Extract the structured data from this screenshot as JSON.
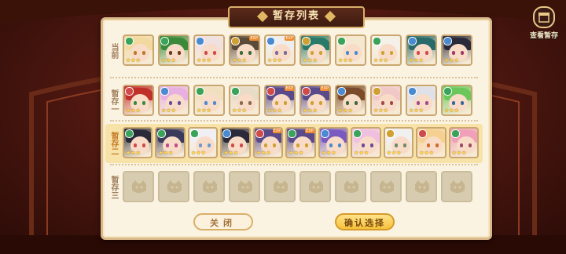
{
  "title": "暂存列表",
  "view_store_label": "查看暂存",
  "rows": [
    {
      "label": "当前",
      "highlight": false,
      "cells": [
        {
          "hair": "#f1d9a0",
          "eye": "#c0782a",
          "elem": "#3aa35a",
          "badge": ""
        },
        {
          "hair": "#3a8a3a",
          "eye": "#6a3a1a",
          "elem": "#3aa35a",
          "badge": ""
        },
        {
          "hair": "#f0e0e0",
          "eye": "#d04a4a",
          "elem": "#4a8ad0",
          "badge": ""
        },
        {
          "hair": "#5a4a3a",
          "eye": "#3a6a3a",
          "elem": "#d0a030",
          "badge": "EXP"
        },
        {
          "hair": "#eeeeee",
          "eye": "#7a6a9a",
          "elem": "#4a8ad0",
          "badge": "EXP"
        },
        {
          "hair": "#2a7a6a",
          "eye": "#d0a030",
          "elem": "#d0a030",
          "badge": ""
        },
        {
          "hair": "#f4e8d0",
          "eye": "#4a8ad0",
          "elem": "#3aa35a",
          "badge": ""
        },
        {
          "hair": "#f5f0e8",
          "eye": "#d0a030",
          "elem": "#3aa35a",
          "badge": ""
        },
        {
          "hair": "#2a6a6a",
          "eye": "#d04a4a",
          "elem": "#4a8ad0",
          "badge": ""
        },
        {
          "hair": "#2a2a3a",
          "eye": "#a03a6a",
          "elem": "#4a8ad0",
          "badge": ""
        }
      ]
    },
    {
      "label": "暂存一",
      "highlight": false,
      "cells": [
        {
          "hair": "#c0302a",
          "eye": "#3a8a3a",
          "elem": "#d04a4a",
          "badge": ""
        },
        {
          "hair": "#e8b0e0",
          "eye": "#6a4a9a",
          "elem": "#4a8ad0",
          "badge": ""
        },
        {
          "hair": "#f0e0c0",
          "eye": "#4a8ad0",
          "elem": "#3aa35a",
          "badge": ""
        },
        {
          "hair": "#e8dcc8",
          "eye": "#8a6a4a",
          "elem": "#3aa35a",
          "badge": ""
        },
        {
          "hair": "#5a4a8a",
          "eye": "#d0a030",
          "elem": "#d04a4a",
          "badge": "EXP"
        },
        {
          "hair": "#5a4a8a",
          "eye": "#d0a030",
          "elem": "#d04a4a",
          "badge": "EXP"
        },
        {
          "hair": "#7a4a2a",
          "eye": "#3a6a3a",
          "elem": "#4a8ad0",
          "badge": ""
        },
        {
          "hair": "#f0c8c8",
          "eye": "#a04a4a",
          "elem": "#d0a030",
          "badge": ""
        },
        {
          "hair": "#e0e0e8",
          "eye": "#a04a8a",
          "elem": "#4a8ad0",
          "badge": ""
        },
        {
          "hair": "#6ac85a",
          "eye": "#3a6a9a",
          "elem": "#3aa35a",
          "badge": ""
        }
      ]
    },
    {
      "label": "暂存二",
      "highlight": true,
      "cells": [
        {
          "hair": "#2a2a3a",
          "eye": "#d04a4a",
          "elem": "#3aa35a",
          "badge": ""
        },
        {
          "hair": "#3a3a5a",
          "eye": "#c04a8a",
          "elem": "#3aa35a",
          "badge": ""
        },
        {
          "hair": "#f0f0f4",
          "eye": "#6a9ad0",
          "elem": "#3aa35a",
          "badge": ""
        },
        {
          "hair": "#2a2a3a",
          "eye": "#d04a4a",
          "elem": "#4a8ad0",
          "badge": ""
        },
        {
          "hair": "#5a4a8a",
          "eye": "#d0a030",
          "elem": "#d04a4a",
          "badge": "EXP"
        },
        {
          "hair": "#5a4a8a",
          "eye": "#d0a030",
          "elem": "#3aa35a",
          "badge": "EXP"
        },
        {
          "hair": "#7a5ac0",
          "eye": "#4a8ad0",
          "elem": "#4a8ad0",
          "badge": ""
        },
        {
          "hair": "#f0c0e0",
          "eye": "#6a4a9a",
          "elem": "#3aa35a",
          "badge": ""
        },
        {
          "hair": "#f0f0f0",
          "eye": "#6a8a6a",
          "elem": "#d0a030",
          "badge": ""
        },
        {
          "hair": "#f5d090",
          "eye": "#d06a2a",
          "elem": "#d04a4a",
          "badge": ""
        },
        {
          "hair": "#f0a0b8",
          "eye": "#a04a6a",
          "elem": "#3aa35a",
          "badge": ""
        }
      ]
    },
    {
      "label": "暂存三",
      "highlight": false,
      "cells": [
        {
          "empty": true
        },
        {
          "empty": true
        },
        {
          "empty": true
        },
        {
          "empty": true
        },
        {
          "empty": true
        },
        {
          "empty": true
        },
        {
          "empty": true
        },
        {
          "empty": true
        },
        {
          "empty": true
        },
        {
          "empty": true
        }
      ]
    }
  ],
  "buttons": {
    "close": "关闭",
    "confirm": "确认选择"
  },
  "colors": {
    "panel_bg": "#fbf3e1",
    "highlight_row": "#f7e3a8",
    "accent": "#f6c23a"
  }
}
